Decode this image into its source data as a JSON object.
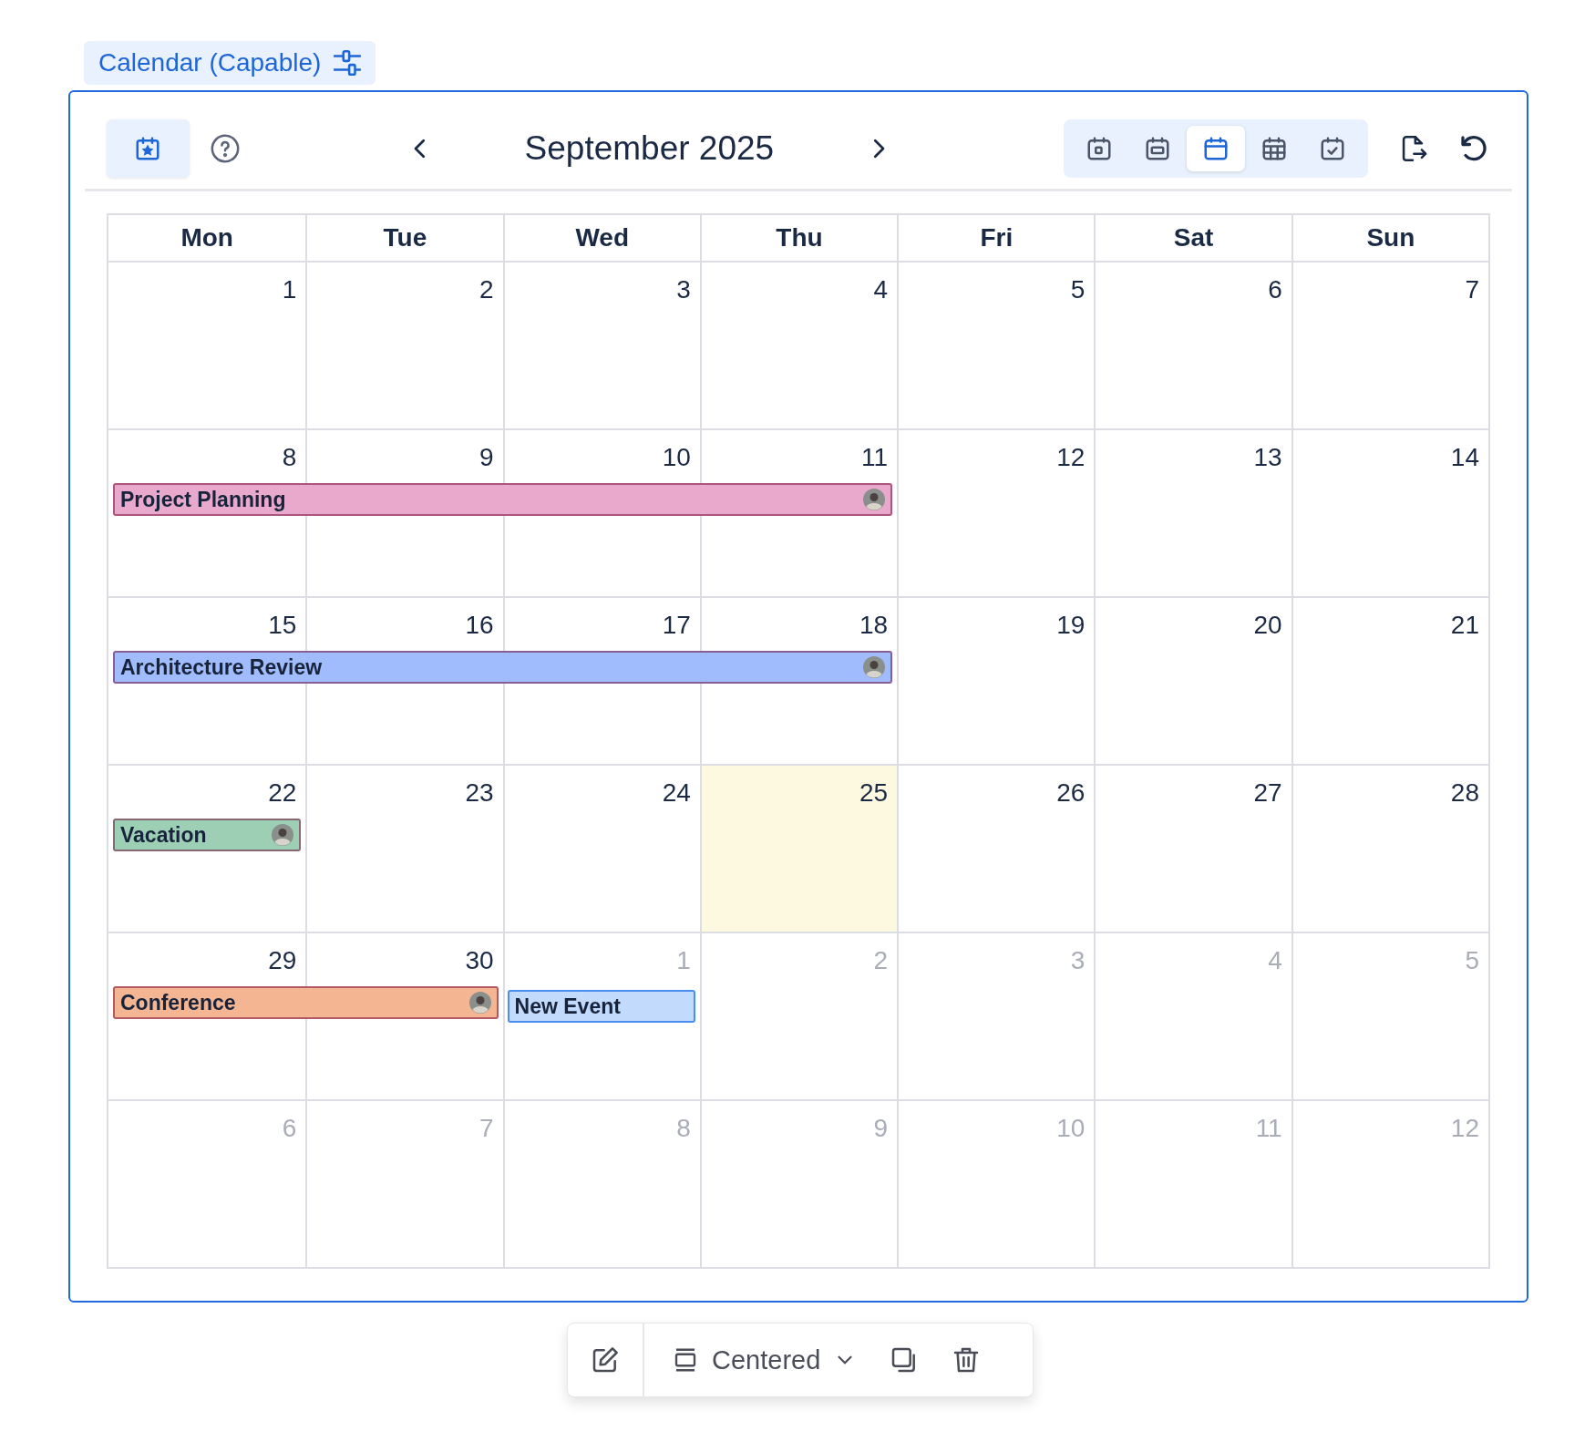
{
  "widget_label": {
    "text": "Calendar (Capable)"
  },
  "toolbar": {
    "title": "September 2025",
    "views": [
      {
        "kind": "day",
        "selected": false
      },
      {
        "kind": "week",
        "selected": false
      },
      {
        "kind": "month",
        "selected": true
      },
      {
        "kind": "year",
        "selected": false
      },
      {
        "kind": "agenda",
        "selected": false
      }
    ],
    "favorite_selected": true
  },
  "weekdays": [
    "Mon",
    "Tue",
    "Wed",
    "Thu",
    "Fri",
    "Sat",
    "Sun"
  ],
  "weeks": [
    {
      "days": [
        {
          "number": "1",
          "in_month": true,
          "today": false
        },
        {
          "number": "2",
          "in_month": true,
          "today": false
        },
        {
          "number": "3",
          "in_month": true,
          "today": false
        },
        {
          "number": "4",
          "in_month": true,
          "today": false
        },
        {
          "number": "5",
          "in_month": true,
          "today": false
        },
        {
          "number": "6",
          "in_month": true,
          "today": false
        },
        {
          "number": "7",
          "in_month": true,
          "today": false
        }
      ]
    },
    {
      "days": [
        {
          "number": "8",
          "in_month": true,
          "today": false,
          "event": {
            "title": "Project Planning",
            "color": "#e9a9cd",
            "kind": "assigned"
          }
        },
        {
          "number": "9",
          "in_month": true,
          "today": false,
          "event_continues": true
        },
        {
          "number": "10",
          "in_month": true,
          "today": false,
          "event_continues": true
        },
        {
          "number": "11",
          "in_month": true,
          "today": false,
          "event_continues": true
        },
        {
          "number": "12",
          "in_month": true,
          "today": false
        },
        {
          "number": "13",
          "in_month": true,
          "today": false
        },
        {
          "number": "14",
          "in_month": true,
          "today": false
        }
      ]
    },
    {
      "days": [
        {
          "number": "15",
          "in_month": true,
          "today": false,
          "event": {
            "title": "Architecture Review",
            "color": "#a0bcfc",
            "kind": "assigned"
          }
        },
        {
          "number": "16",
          "in_month": true,
          "today": false,
          "event_continues": true
        },
        {
          "number": "17",
          "in_month": true,
          "today": false,
          "event_continues": true
        },
        {
          "number": "18",
          "in_month": true,
          "today": false,
          "event_continues": true
        },
        {
          "number": "19",
          "in_month": true,
          "today": false
        },
        {
          "number": "20",
          "in_month": true,
          "today": false
        },
        {
          "number": "21",
          "in_month": true,
          "today": false
        }
      ]
    },
    {
      "days": [
        {
          "number": "22",
          "in_month": true,
          "today": false,
          "event": {
            "title": "Vacation",
            "color": "#9ccfb3",
            "kind": "assigned"
          }
        },
        {
          "number": "23",
          "in_month": true,
          "today": false
        },
        {
          "number": "24",
          "in_month": true,
          "today": false
        },
        {
          "number": "25",
          "in_month": true,
          "today": true
        },
        {
          "number": "26",
          "in_month": true,
          "today": false
        },
        {
          "number": "27",
          "in_month": true,
          "today": false
        },
        {
          "number": "28",
          "in_month": true,
          "today": false
        }
      ]
    },
    {
      "days": [
        {
          "number": "29",
          "in_month": true,
          "today": false,
          "event": {
            "title": "Conference",
            "color": "#f4b592",
            "kind": "assigned"
          }
        },
        {
          "number": "30",
          "in_month": true,
          "today": false,
          "event_continues": true
        },
        {
          "number": "1",
          "in_month": false,
          "today": false,
          "event": {
            "title": "New Event",
            "color": "#c2dafc",
            "kind": "new"
          }
        },
        {
          "number": "2",
          "in_month": false,
          "today": false
        },
        {
          "number": "3",
          "in_month": false,
          "today": false
        },
        {
          "number": "4",
          "in_month": false,
          "today": false
        },
        {
          "number": "5",
          "in_month": false,
          "today": false
        }
      ]
    },
    {
      "days": [
        {
          "number": "6",
          "in_month": false,
          "today": false
        },
        {
          "number": "7",
          "in_month": false,
          "today": false
        },
        {
          "number": "8",
          "in_month": false,
          "today": false
        },
        {
          "number": "9",
          "in_month": false,
          "today": false
        },
        {
          "number": "10",
          "in_month": false,
          "today": false
        },
        {
          "number": "11",
          "in_month": false,
          "today": false
        },
        {
          "number": "12",
          "in_month": false,
          "today": false
        }
      ]
    }
  ],
  "bottom_toolbar": {
    "layout": "Centered"
  }
}
